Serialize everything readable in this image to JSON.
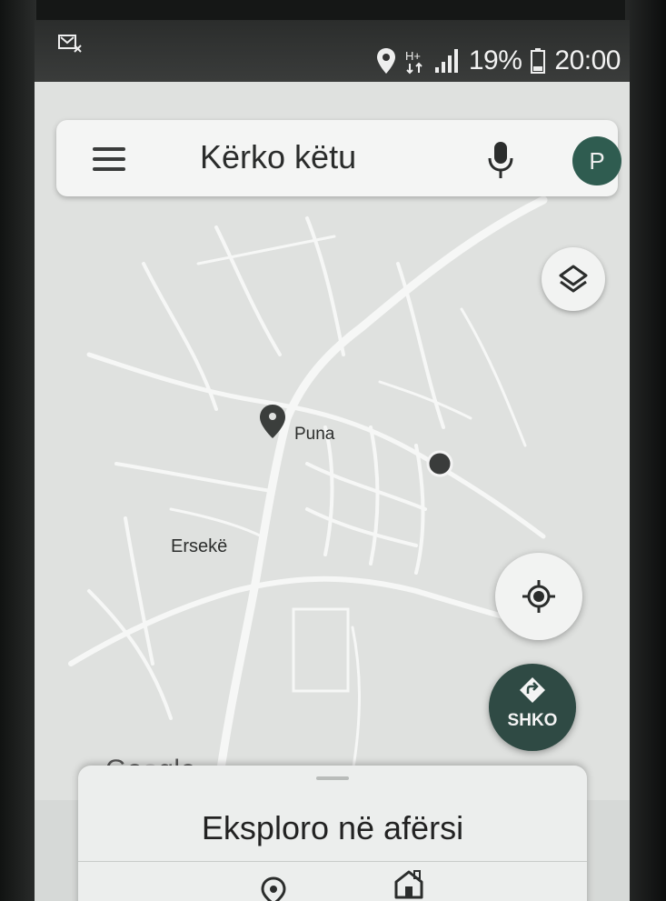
{
  "status_bar": {
    "battery_percent": "19%",
    "time": "20:00",
    "icons": [
      "notification-icon",
      "location-icon",
      "data-icon",
      "signal-icon",
      "battery-icon"
    ]
  },
  "search": {
    "placeholder": "Kërko këtu",
    "avatar_letter": "P",
    "menu_icon": "menu-icon",
    "mic_icon": "mic-icon"
  },
  "map": {
    "places": [
      {
        "name": "Puna"
      },
      {
        "name": "Ersekë"
      }
    ],
    "logo": {
      "part1": "Go",
      "part2": "o",
      "part3": "gle"
    },
    "layers_icon": "layers-icon",
    "location_icon": "my-location-icon"
  },
  "go_button": {
    "label": "SHKO",
    "icon": "directions-icon"
  },
  "bottom_sheet": {
    "title": "Eksploro në afërsi",
    "icons": [
      "explore-icon",
      "home-icon"
    ]
  },
  "colors": {
    "avatar": "#2f5c50",
    "go_button": "#2f4a44",
    "status_bar": "#2b2d2c"
  }
}
